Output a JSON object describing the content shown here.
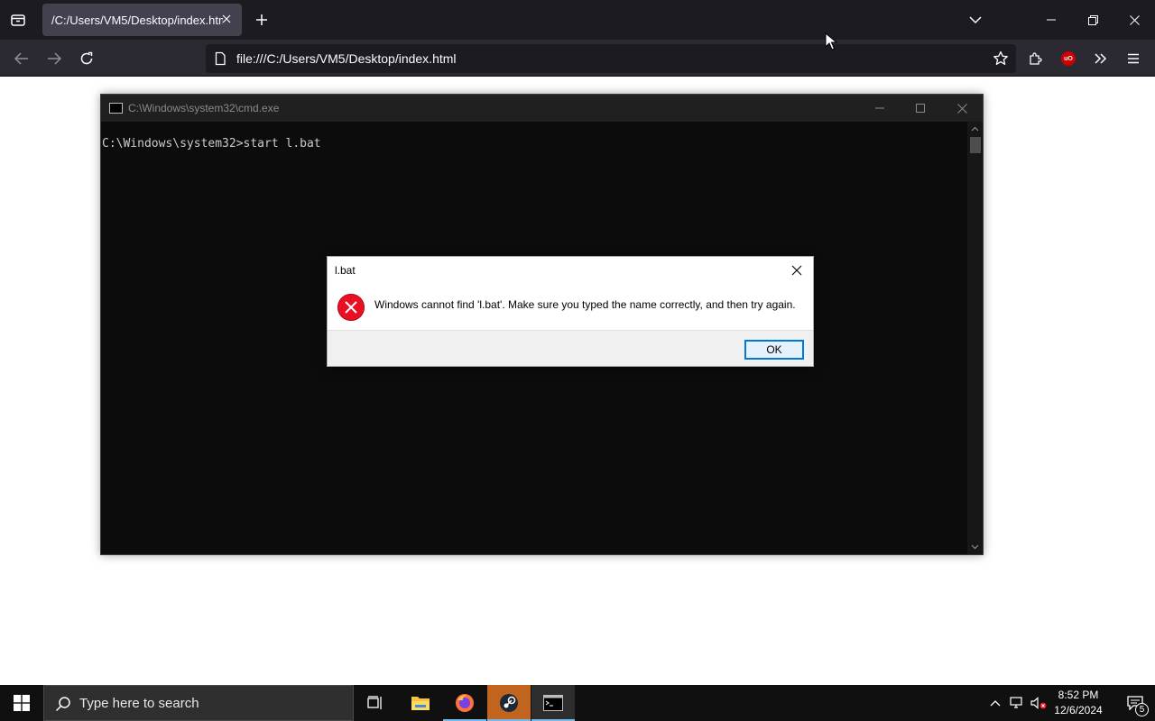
{
  "browser": {
    "tab_title": "/C:/Users/VM5/Desktop/index.html",
    "url": "file:///C:/Users/VM5/Desktop/index.html",
    "ublock_label": "uO"
  },
  "cmd": {
    "title": "C:\\Windows\\system32\\cmd.exe",
    "lines": [
      "C:\\Windows\\system32>start l.bat"
    ]
  },
  "dialog": {
    "title": "l.bat",
    "message": "Windows cannot find 'l.bat'. Make sure you typed the name correctly, and then try again.",
    "ok_label": "OK"
  },
  "taskbar": {
    "search_placeholder": "Type here to search",
    "time": "8:52 PM",
    "date": "12/6/2024",
    "notification_count": "5"
  },
  "colors": {
    "error_red": "#e81123",
    "accent_blue": "#0078d7",
    "steam_highlight": "#c0641e"
  }
}
